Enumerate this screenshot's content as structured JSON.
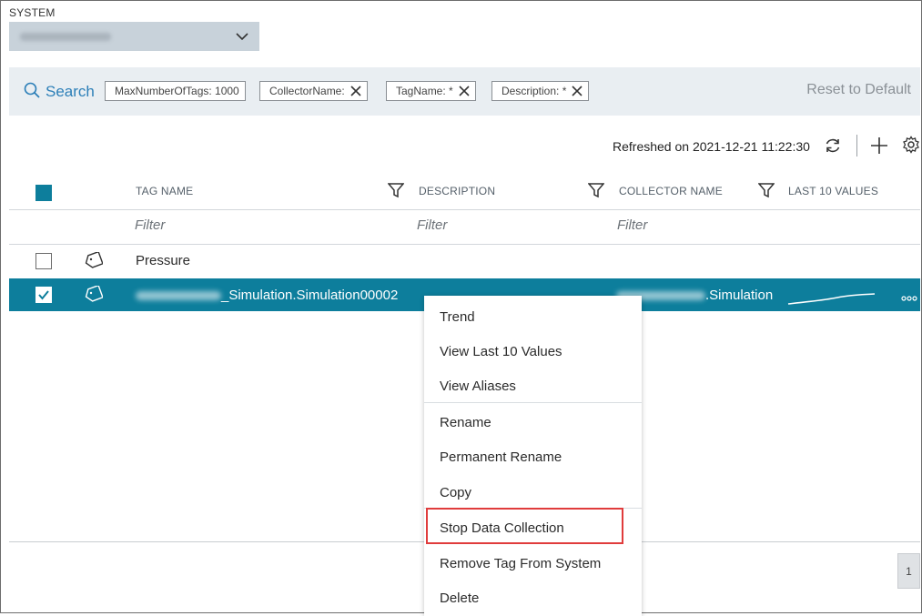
{
  "system": {
    "label": "SYSTEM",
    "selected_value_redacted": true
  },
  "search": {
    "label": "Search",
    "chips": [
      {
        "text": "MaxNumberOfTags: 1000",
        "removable": false
      },
      {
        "text": "CollectorName:",
        "removable": true
      },
      {
        "text": "TagName: *",
        "removable": true
      },
      {
        "text": "Description: *",
        "removable": true
      }
    ],
    "reset_label": "Reset to Default"
  },
  "toolbar": {
    "refreshed_text": "Refreshed on 2021-12-21 11:22:30"
  },
  "table": {
    "columns": [
      "TAG NAME",
      "DESCRIPTION",
      "COLLECTOR NAME",
      "LAST 10 VALUES"
    ],
    "filter_placeholder": "Filter",
    "rows": [
      {
        "tag_name": "Pressure",
        "description": "",
        "collector": "",
        "checked": false
      },
      {
        "tag_name_suffix": "_Simulation.Simulation00002",
        "collector_suffix": ".Simulation",
        "checked": true,
        "selected": true
      }
    ]
  },
  "context_menu": {
    "items": [
      "Trend",
      "View Last 10 Values",
      "View Aliases",
      "Rename",
      "Permanent Rename",
      "Copy",
      "Stop Data Collection",
      "Remove Tag From System",
      "Delete"
    ],
    "highlighted_item": "Stop Data Collection"
  },
  "pagination": {
    "current_page": "1"
  },
  "colors": {
    "accent": "#0d7e9c",
    "link": "#2c7fb8",
    "highlight_border": "#e03c3c"
  }
}
